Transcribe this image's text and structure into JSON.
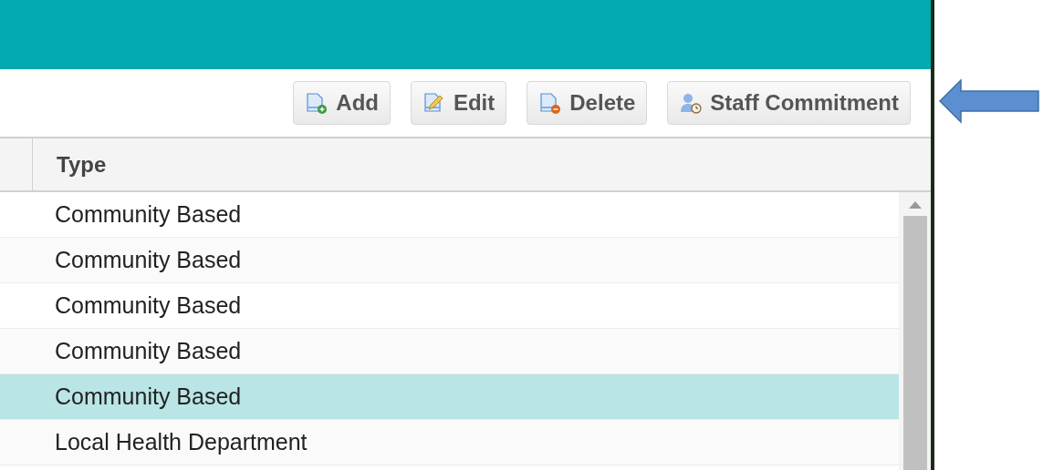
{
  "toolbar": {
    "buttons": [
      {
        "kind": "add",
        "label": "Add"
      },
      {
        "kind": "edit",
        "label": "Edit"
      },
      {
        "kind": "delete",
        "label": "Delete"
      },
      {
        "kind": "staff",
        "label": "Staff Commitment"
      }
    ]
  },
  "table": {
    "columns": [
      "Type"
    ],
    "rows": [
      {
        "type": "Community Based",
        "selected": false
      },
      {
        "type": "Community Based",
        "selected": false
      },
      {
        "type": "Community Based",
        "selected": false
      },
      {
        "type": "Community Based",
        "selected": false
      },
      {
        "type": "Community Based",
        "selected": true
      },
      {
        "type": "Local Health Department",
        "selected": false
      }
    ]
  }
}
